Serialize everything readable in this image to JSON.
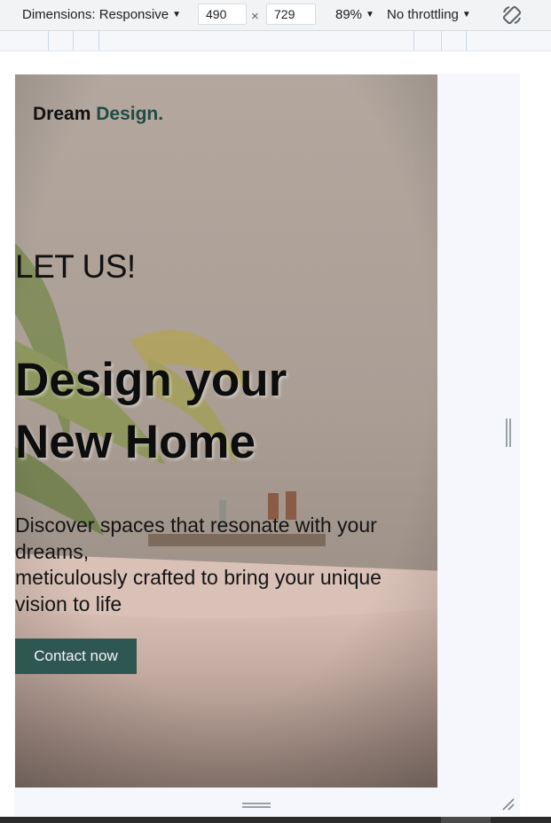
{
  "devtools": {
    "dimensions_label": "Dimensions: Responsive",
    "width_value": "490",
    "height_value": "729",
    "times_symbol": "×",
    "zoom": "89%",
    "throttling": "No throttling",
    "rotate_icon": "rotate-icon"
  },
  "site": {
    "brand": {
      "first": "Dream",
      "second": "Design."
    },
    "hero": {
      "kicker": "LET US!",
      "headline_line1": "Design your",
      "headline_line2": "New Home",
      "sub_line1": "Discover spaces that resonate with your",
      "sub_line2": "dreams,",
      "sub_line3": "meticulously crafted to bring your unique",
      "sub_line4": "vision to life",
      "cta": "Contact now"
    }
  },
  "colors": {
    "brand_accent": "#1f4b46",
    "button_bg": "#2f5752",
    "button_text": "#f4f4f4"
  }
}
